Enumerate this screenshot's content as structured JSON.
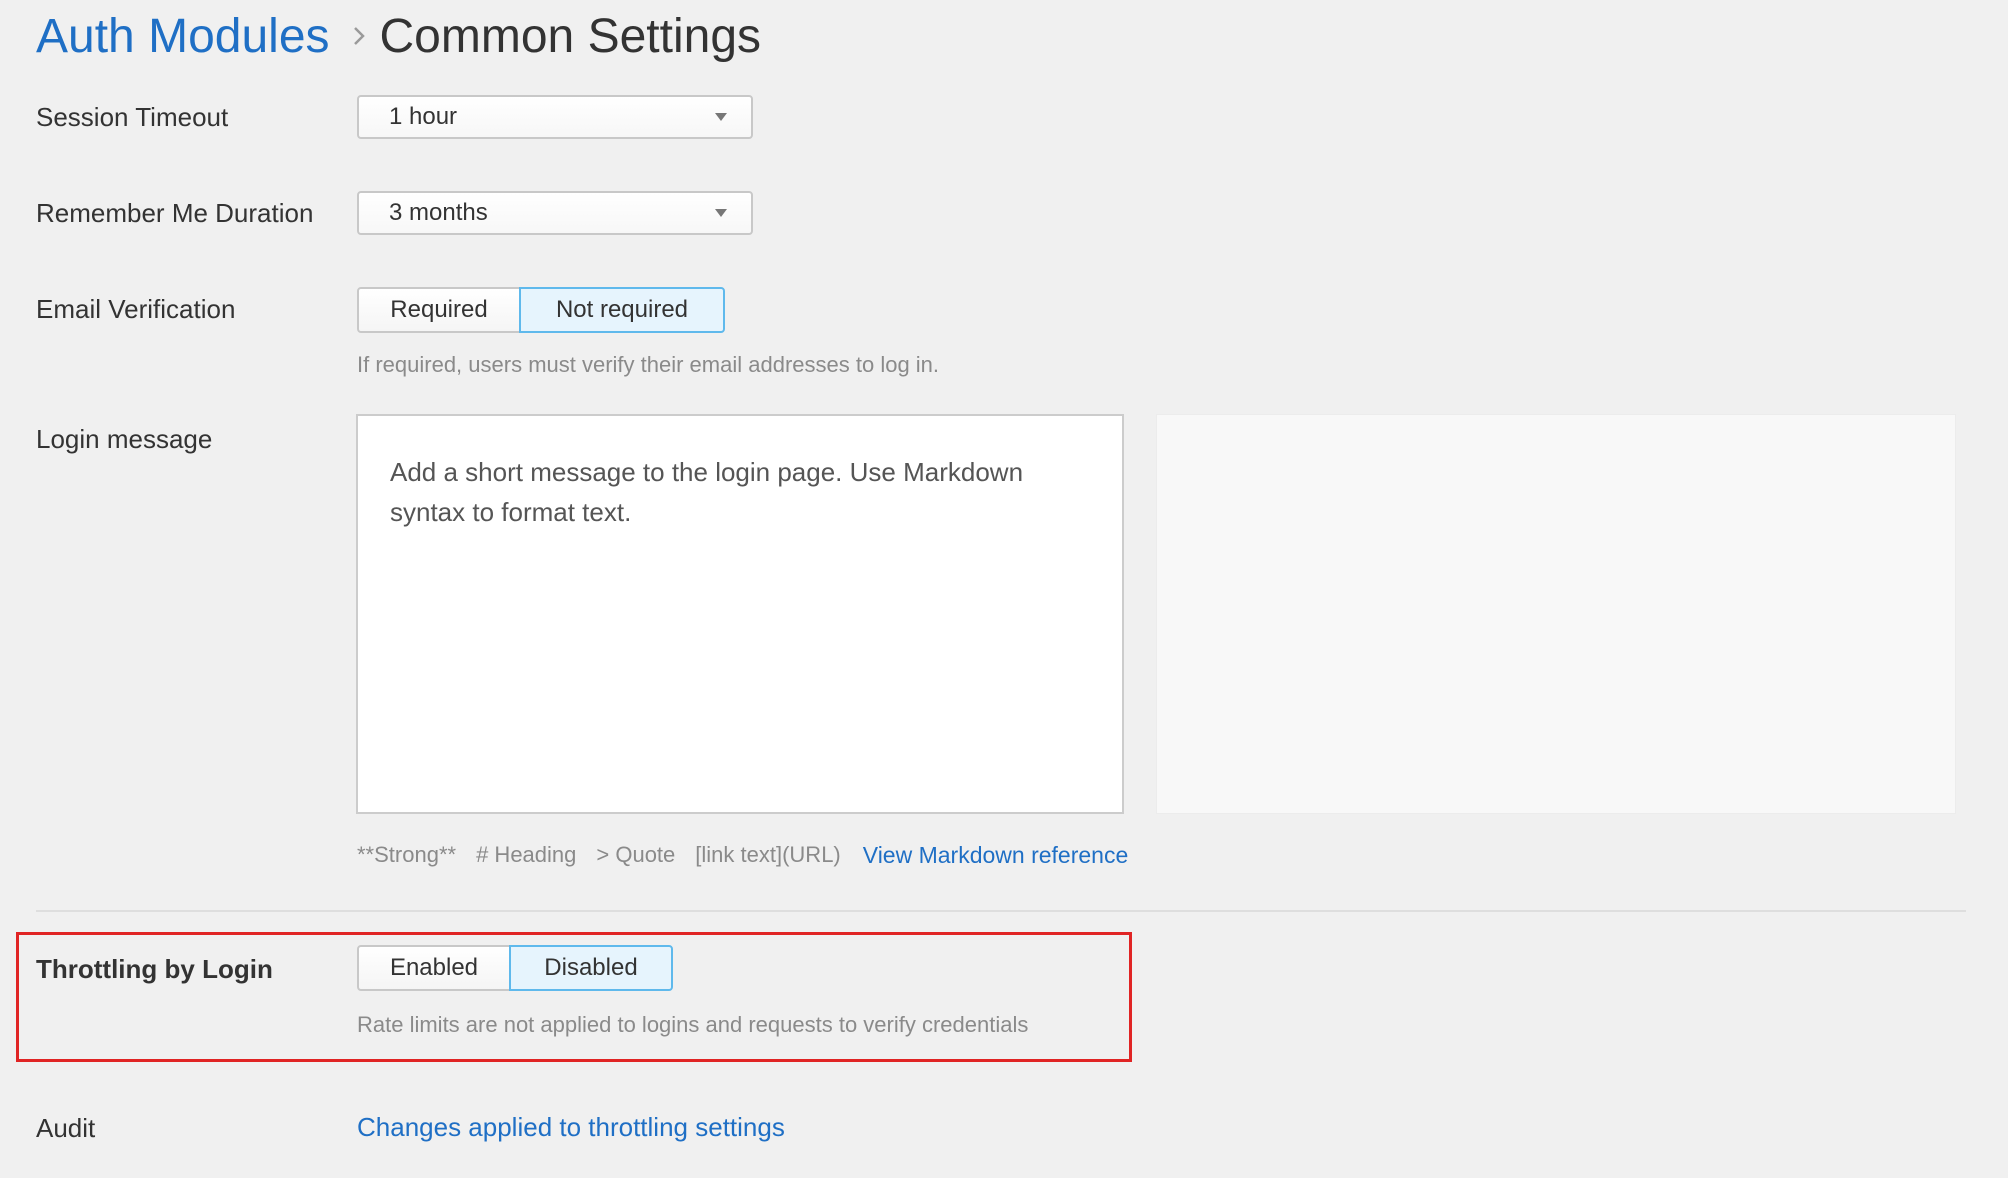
{
  "breadcrumb": {
    "parent": "Auth Modules",
    "separator_icon": "chevron-right-icon",
    "current": "Common Settings"
  },
  "session_timeout": {
    "label": "Session Timeout",
    "value": "1 hour",
    "caret_icon": "caret-down-icon"
  },
  "remember_me": {
    "label": "Remember Me Duration",
    "value": "3 months",
    "caret_icon": "caret-down-icon"
  },
  "email_verification": {
    "label": "Email Verification",
    "options": [
      "Required",
      "Not required"
    ],
    "selected": "Not required",
    "help": "If required, users must verify their email addresses to log in."
  },
  "login_message": {
    "label": "Login message",
    "placeholder": "Add a short message to the login page. Use Markdown syntax to format text.",
    "hints": [
      "**Strong**",
      "# Heading",
      "> Quote",
      "[link text](URL)"
    ],
    "reference_link": "View Markdown reference"
  },
  "throttling": {
    "label": "Throttling by Login",
    "options": [
      "Enabled",
      "Disabled"
    ],
    "selected": "Disabled",
    "help": "Rate limits are not applied to logins and requests to verify credentials",
    "highlight_color": "#e02424"
  },
  "audit": {
    "label": "Audit",
    "link": "Changes applied to throttling settings"
  },
  "colors": {
    "link": "#1f6fc5",
    "background": "#f0f0f0",
    "active_border": "#5fb9ec",
    "active_fill": "#e6f4fd"
  }
}
